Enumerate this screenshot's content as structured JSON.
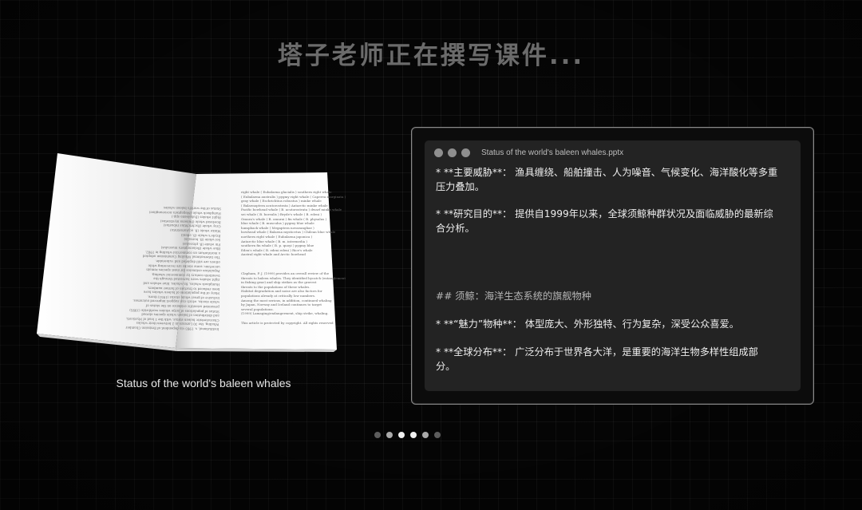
{
  "heading": "塔子老师正在撰写课件...",
  "book": {
    "caption": "Status of the world's baleen whales",
    "left_text": "Institutional, s. 1993 via dependent of Emission Chamber\nWhaling, the 30 Lorenzo in 2 between their whales\nCharacteristic baleen status, with the 1 lead of Mysticeti,\nand distribution of baleen whale species abroad\nStatus of populations of large whales worldwide (1995)\npresented scientific evidence on the status of\nwhale stocks, which can suggest improved outcomes,\ninclusive of great whale stocks (1951) there.\nMany of the populations of baleen whales have\nbeen reduced to fraction of former numbers.\nHumpback whales, fin whales, blue whales and\nright whales were harvested through the\ntwentieth century by commercial whaling.\nPopulation estimates for most species remain\nuncertain; some stocks are recovering while\nothers are still depleted and vulnerable.\nThe International Whaling Commission adopted\na moratorium on commercial whaling in 1982.\nBlue whale (Balaenoptera musculus)\nFin whale (B. physalus)\nSei whale (B. borealis)\nBryde's whale (B. edeni)\nMinke whale (B. acutorostrata)\nGray whale (Eschrichtius robustus)\nBowhead whale (Balaena mysticetus)\nRight whales (Eubalaena spp.)\nHumpback whale (Megaptera novaeangliae)\nStatus of the world's baleen whales",
    "right_text": "right whale ( Eubalaena glacialis ) southern right whale\n( Eubalaena australis ) pygmy right whale ( Caperea marginata )\ngray whale ( Eschrichtius robustus ) minke whale\n( Balaenoptera acutorostrata ) Antarctic minke whale\nPacific bowhead whale ( B. acutorostrata ) dwarf minke whale\nsei whale ( B. borealis ) Bryde's whale ( B. edeni )\nOmura's whale ( B. omurai ) fin whale ( B. physalus )\nblue whale ( B. musculus ) pygmy blue whale\nhumpback whale ( Megaptera novaeangliae )\nbowhead whale ( Balaena mysticetus ) Chilean blue whale\nnorthern right whale ( Eubalaena japonica )\nAntarctic blue whale ( B. m. intermedia )\nsouthern fin whale ( B. p. quoyi ) pygmy blue\nEden's whale ( B. edeni edeni ) Rice's whale\nAustral right whale and Arctic bowhead",
    "right_text_bottom": "Clapham, P. J. (1999) provides an overall review of the\nthreats to baleen whales. They identified bycatch (entanglement\nin fishing gear) and ship strikes as the gravest\nthreats to the populations of these whales.\nHabitat degradation and noise are also factors for\npopulations already at critically low numbers.\nAmong the most serious, in addition, continued whaling\nby Japan, Norway and Iceland continues to target\nseveral populations.\n(1999) Lamaging/endangerment, ship strike, whaling.\n\nThis article is protected by copyright. All rights reserved"
  },
  "window": {
    "title": "Status of the world's baleen whales.pptx",
    "lines": [
      {
        "text": "*    **主要威胁**：   渔具缠绕、船舶撞击、人为噪音、气候变化、海洋酸化等多重",
        "muted": false
      },
      {
        "text": "压力叠加。",
        "muted": false
      },
      {
        "text": "*    **研究目的**：   提供自1999年以来，全球须鲸种群状况及面临威胁的最新综",
        "muted": false
      },
      {
        "text": "合分析。",
        "muted": false
      },
      {
        "text": "##  须鲸：海洋生态系统的旗舰物种",
        "muted": true
      },
      {
        "text": "*    **“魅力”物种**：  体型庞大、外形独特、行为复杂，深受公众喜爱。",
        "muted": false
      },
      {
        "text": "*    **全球分布**：   广泛分布于世界各大洋，是重要的海洋生物多样性组成部",
        "muted": false
      },
      {
        "text": "分。",
        "muted": false
      }
    ]
  },
  "pager": {
    "count": 6,
    "active_index": 3
  },
  "colors": {
    "background": "#060606",
    "window": "#232323",
    "frame": "#8a8a8a",
    "heading": "#6b6b6b"
  }
}
